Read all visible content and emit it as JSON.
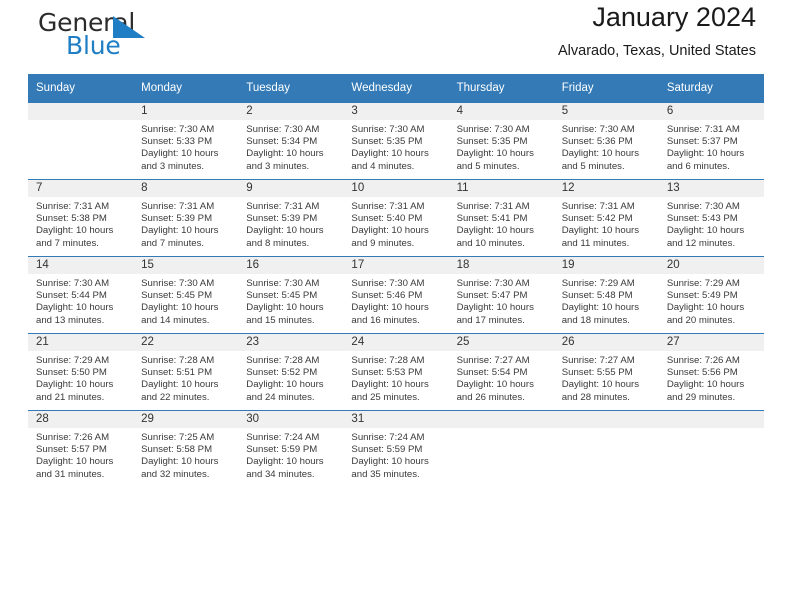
{
  "brand": {
    "name_part1": "General",
    "name_part2": "Blue",
    "logo_icon": "flag-triangle-icon",
    "accent_color": "#1f7ec4"
  },
  "header": {
    "title": "January 2024",
    "subtitle": "Alvarado, Texas, United States",
    "header_bg_color": "#337ab7",
    "header_text_color": "#ffffff"
  },
  "calendar": {
    "weekday_headers": [
      "Sunday",
      "Monday",
      "Tuesday",
      "Wednesday",
      "Thursday",
      "Friday",
      "Saturday"
    ],
    "weeks": [
      [
        {
          "day": "",
          "empty": true,
          "sunrise": "",
          "sunset": "",
          "daylight_line1": "",
          "daylight_line2": ""
        },
        {
          "day": "1",
          "sunrise": "Sunrise: 7:30 AM",
          "sunset": "Sunset: 5:33 PM",
          "daylight_line1": "Daylight: 10 hours",
          "daylight_line2": "and 3 minutes."
        },
        {
          "day": "2",
          "sunrise": "Sunrise: 7:30 AM",
          "sunset": "Sunset: 5:34 PM",
          "daylight_line1": "Daylight: 10 hours",
          "daylight_line2": "and 3 minutes."
        },
        {
          "day": "3",
          "sunrise": "Sunrise: 7:30 AM",
          "sunset": "Sunset: 5:35 PM",
          "daylight_line1": "Daylight: 10 hours",
          "daylight_line2": "and 4 minutes."
        },
        {
          "day": "4",
          "sunrise": "Sunrise: 7:30 AM",
          "sunset": "Sunset: 5:35 PM",
          "daylight_line1": "Daylight: 10 hours",
          "daylight_line2": "and 5 minutes."
        },
        {
          "day": "5",
          "sunrise": "Sunrise: 7:30 AM",
          "sunset": "Sunset: 5:36 PM",
          "daylight_line1": "Daylight: 10 hours",
          "daylight_line2": "and 5 minutes."
        },
        {
          "day": "6",
          "sunrise": "Sunrise: 7:31 AM",
          "sunset": "Sunset: 5:37 PM",
          "daylight_line1": "Daylight: 10 hours",
          "daylight_line2": "and 6 minutes."
        }
      ],
      [
        {
          "day": "7",
          "sunrise": "Sunrise: 7:31 AM",
          "sunset": "Sunset: 5:38 PM",
          "daylight_line1": "Daylight: 10 hours",
          "daylight_line2": "and 7 minutes."
        },
        {
          "day": "8",
          "sunrise": "Sunrise: 7:31 AM",
          "sunset": "Sunset: 5:39 PM",
          "daylight_line1": "Daylight: 10 hours",
          "daylight_line2": "and 7 minutes."
        },
        {
          "day": "9",
          "sunrise": "Sunrise: 7:31 AM",
          "sunset": "Sunset: 5:39 PM",
          "daylight_line1": "Daylight: 10 hours",
          "daylight_line2": "and 8 minutes."
        },
        {
          "day": "10",
          "sunrise": "Sunrise: 7:31 AM",
          "sunset": "Sunset: 5:40 PM",
          "daylight_line1": "Daylight: 10 hours",
          "daylight_line2": "and 9 minutes."
        },
        {
          "day": "11",
          "sunrise": "Sunrise: 7:31 AM",
          "sunset": "Sunset: 5:41 PM",
          "daylight_line1": "Daylight: 10 hours",
          "daylight_line2": "and 10 minutes."
        },
        {
          "day": "12",
          "sunrise": "Sunrise: 7:31 AM",
          "sunset": "Sunset: 5:42 PM",
          "daylight_line1": "Daylight: 10 hours",
          "daylight_line2": "and 11 minutes."
        },
        {
          "day": "13",
          "sunrise": "Sunrise: 7:30 AM",
          "sunset": "Sunset: 5:43 PM",
          "daylight_line1": "Daylight: 10 hours",
          "daylight_line2": "and 12 minutes."
        }
      ],
      [
        {
          "day": "14",
          "sunrise": "Sunrise: 7:30 AM",
          "sunset": "Sunset: 5:44 PM",
          "daylight_line1": "Daylight: 10 hours",
          "daylight_line2": "and 13 minutes."
        },
        {
          "day": "15",
          "sunrise": "Sunrise: 7:30 AM",
          "sunset": "Sunset: 5:45 PM",
          "daylight_line1": "Daylight: 10 hours",
          "daylight_line2": "and 14 minutes."
        },
        {
          "day": "16",
          "sunrise": "Sunrise: 7:30 AM",
          "sunset": "Sunset: 5:45 PM",
          "daylight_line1": "Daylight: 10 hours",
          "daylight_line2": "and 15 minutes."
        },
        {
          "day": "17",
          "sunrise": "Sunrise: 7:30 AM",
          "sunset": "Sunset: 5:46 PM",
          "daylight_line1": "Daylight: 10 hours",
          "daylight_line2": "and 16 minutes."
        },
        {
          "day": "18",
          "sunrise": "Sunrise: 7:30 AM",
          "sunset": "Sunset: 5:47 PM",
          "daylight_line1": "Daylight: 10 hours",
          "daylight_line2": "and 17 minutes."
        },
        {
          "day": "19",
          "sunrise": "Sunrise: 7:29 AM",
          "sunset": "Sunset: 5:48 PM",
          "daylight_line1": "Daylight: 10 hours",
          "daylight_line2": "and 18 minutes."
        },
        {
          "day": "20",
          "sunrise": "Sunrise: 7:29 AM",
          "sunset": "Sunset: 5:49 PM",
          "daylight_line1": "Daylight: 10 hours",
          "daylight_line2": "and 20 minutes."
        }
      ],
      [
        {
          "day": "21",
          "sunrise": "Sunrise: 7:29 AM",
          "sunset": "Sunset: 5:50 PM",
          "daylight_line1": "Daylight: 10 hours",
          "daylight_line2": "and 21 minutes."
        },
        {
          "day": "22",
          "sunrise": "Sunrise: 7:28 AM",
          "sunset": "Sunset: 5:51 PM",
          "daylight_line1": "Daylight: 10 hours",
          "daylight_line2": "and 22 minutes."
        },
        {
          "day": "23",
          "sunrise": "Sunrise: 7:28 AM",
          "sunset": "Sunset: 5:52 PM",
          "daylight_line1": "Daylight: 10 hours",
          "daylight_line2": "and 24 minutes."
        },
        {
          "day": "24",
          "sunrise": "Sunrise: 7:28 AM",
          "sunset": "Sunset: 5:53 PM",
          "daylight_line1": "Daylight: 10 hours",
          "daylight_line2": "and 25 minutes."
        },
        {
          "day": "25",
          "sunrise": "Sunrise: 7:27 AM",
          "sunset": "Sunset: 5:54 PM",
          "daylight_line1": "Daylight: 10 hours",
          "daylight_line2": "and 26 minutes."
        },
        {
          "day": "26",
          "sunrise": "Sunrise: 7:27 AM",
          "sunset": "Sunset: 5:55 PM",
          "daylight_line1": "Daylight: 10 hours",
          "daylight_line2": "and 28 minutes."
        },
        {
          "day": "27",
          "sunrise": "Sunrise: 7:26 AM",
          "sunset": "Sunset: 5:56 PM",
          "daylight_line1": "Daylight: 10 hours",
          "daylight_line2": "and 29 minutes."
        }
      ],
      [
        {
          "day": "28",
          "sunrise": "Sunrise: 7:26 AM",
          "sunset": "Sunset: 5:57 PM",
          "daylight_line1": "Daylight: 10 hours",
          "daylight_line2": "and 31 minutes."
        },
        {
          "day": "29",
          "sunrise": "Sunrise: 7:25 AM",
          "sunset": "Sunset: 5:58 PM",
          "daylight_line1": "Daylight: 10 hours",
          "daylight_line2": "and 32 minutes."
        },
        {
          "day": "30",
          "sunrise": "Sunrise: 7:24 AM",
          "sunset": "Sunset: 5:59 PM",
          "daylight_line1": "Daylight: 10 hours",
          "daylight_line2": "and 34 minutes."
        },
        {
          "day": "31",
          "sunrise": "Sunrise: 7:24 AM",
          "sunset": "Sunset: 5:59 PM",
          "daylight_line1": "Daylight: 10 hours",
          "daylight_line2": "and 35 minutes."
        },
        {
          "day": "",
          "empty": true,
          "sunrise": "",
          "sunset": "",
          "daylight_line1": "",
          "daylight_line2": ""
        },
        {
          "day": "",
          "empty": true,
          "sunrise": "",
          "sunset": "",
          "daylight_line1": "",
          "daylight_line2": ""
        },
        {
          "day": "",
          "empty": true,
          "sunrise": "",
          "sunset": "",
          "daylight_line1": "",
          "daylight_line2": ""
        }
      ]
    ]
  }
}
